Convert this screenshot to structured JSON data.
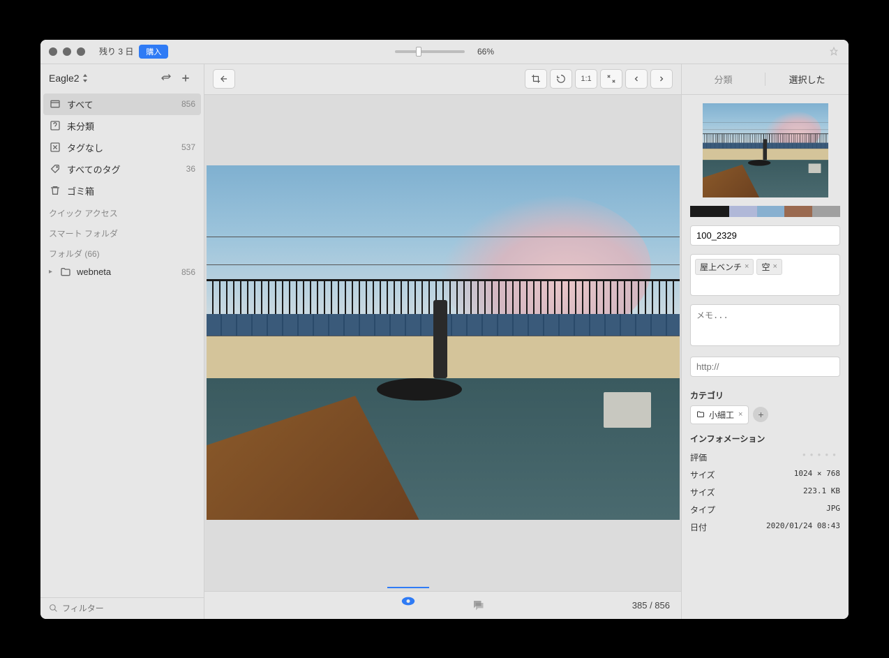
{
  "titlebar": {
    "trial_text": "残り 3 日",
    "buy_label": "購入",
    "zoom_pct": "66%"
  },
  "sidebar": {
    "library_name": "Eagle2",
    "items": [
      {
        "label": "すべて",
        "count": "856"
      },
      {
        "label": "未分類",
        "count": ""
      },
      {
        "label": "タグなし",
        "count": "537"
      },
      {
        "label": "すべてのタグ",
        "count": "36"
      },
      {
        "label": "ゴミ箱",
        "count": ""
      }
    ],
    "sections": {
      "quick_access": "クイック アクセス",
      "smart_folder": "スマート フォルダ",
      "folder": "フォルダ (66)"
    },
    "folders": [
      {
        "name": "webneta",
        "count": "856"
      }
    ],
    "filter_placeholder": "フィルター"
  },
  "bottombar": {
    "counter": "385 / 856"
  },
  "inspector": {
    "tabs": {
      "classify": "分類",
      "selected": "選択した"
    },
    "swatches": [
      "#1a1a1a",
      "#b0b8d8",
      "#88b0d0",
      "#9a6a50",
      "#a0a0a0"
    ],
    "filename": "100_2329",
    "tags": [
      "屋上ベンチ",
      "空"
    ],
    "memo_placeholder": "メモ...",
    "url_placeholder": "http://",
    "category_label": "カテゴリ",
    "categories": [
      "小細工"
    ],
    "info_label": "インフォメーション",
    "info": {
      "rating_label": "評価",
      "size_label": "サイズ",
      "dimensions": "1024 × 768",
      "filesize": "223.1 KB",
      "type_label": "タイプ",
      "type_value": "JPG",
      "date_label": "日付",
      "date_value": "2020/01/24 08:43"
    }
  }
}
